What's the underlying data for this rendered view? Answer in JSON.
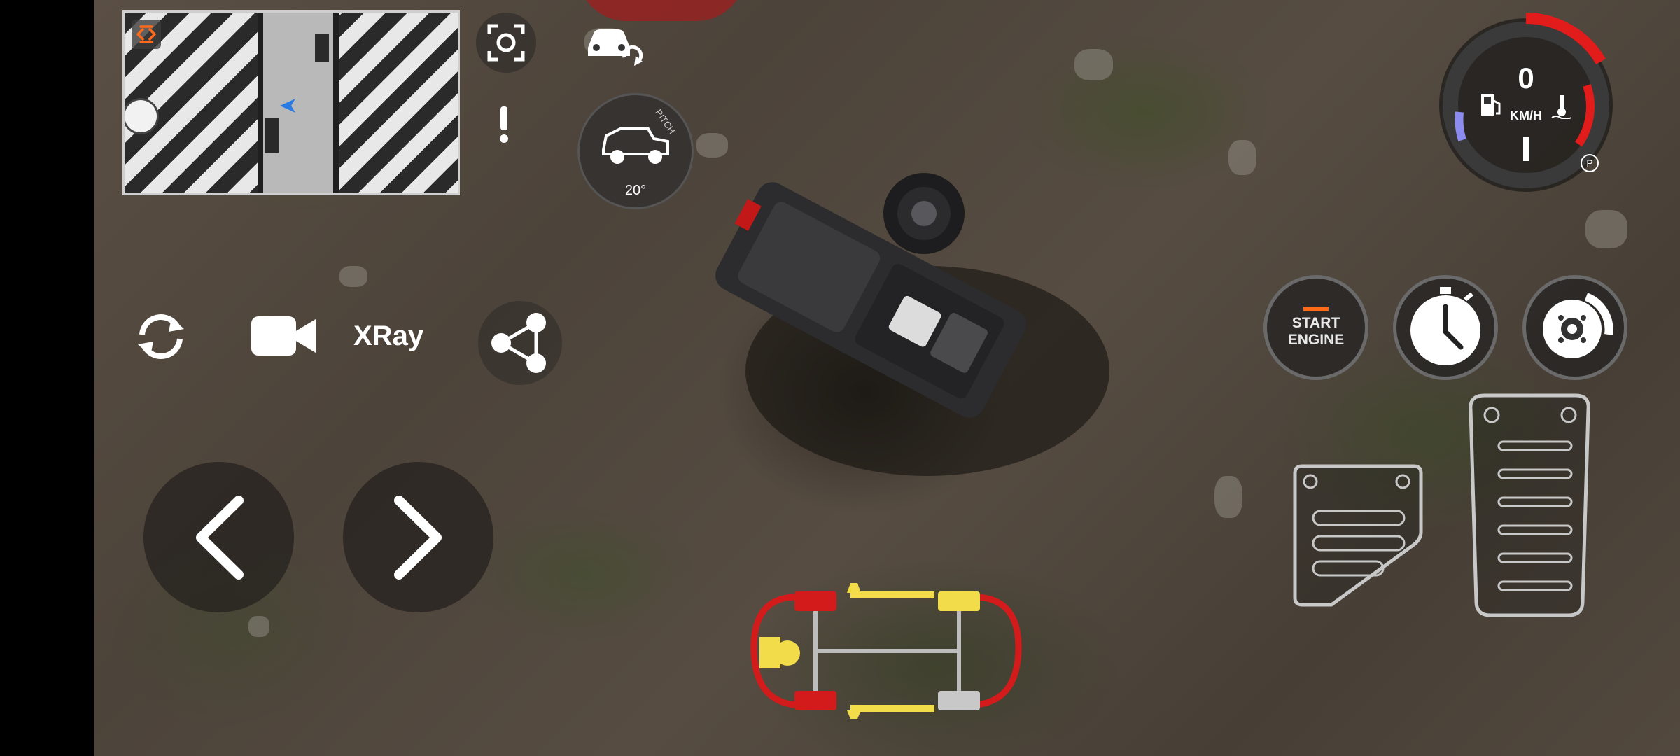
{
  "minimap": {
    "icons": [
      "expand-icon",
      "player-marker-icon"
    ]
  },
  "camera_controls": {
    "xray_label": "XRay",
    "icons": [
      "rotate-camera-icon",
      "video-camera-icon",
      "share-icon",
      "screenshot-icon",
      "swap-car-icon",
      "alert-icon"
    ]
  },
  "pitch_gauge": {
    "label": "PITCH",
    "value": "20°"
  },
  "speedometer": {
    "speed": "0",
    "unit": "KM/H",
    "gear_indicator": "P"
  },
  "engine": {
    "start_line1": "START",
    "start_line2": "ENGINE"
  },
  "steering": {
    "left_icon": "chevron-left-icon",
    "right_icon": "chevron-right-icon"
  },
  "colors": {
    "accent_red": "#e21b1b",
    "accent_yellow": "#f3dc4a",
    "cool_blue": "#8c8cf0",
    "engine_orange": "#ff6a1a"
  }
}
